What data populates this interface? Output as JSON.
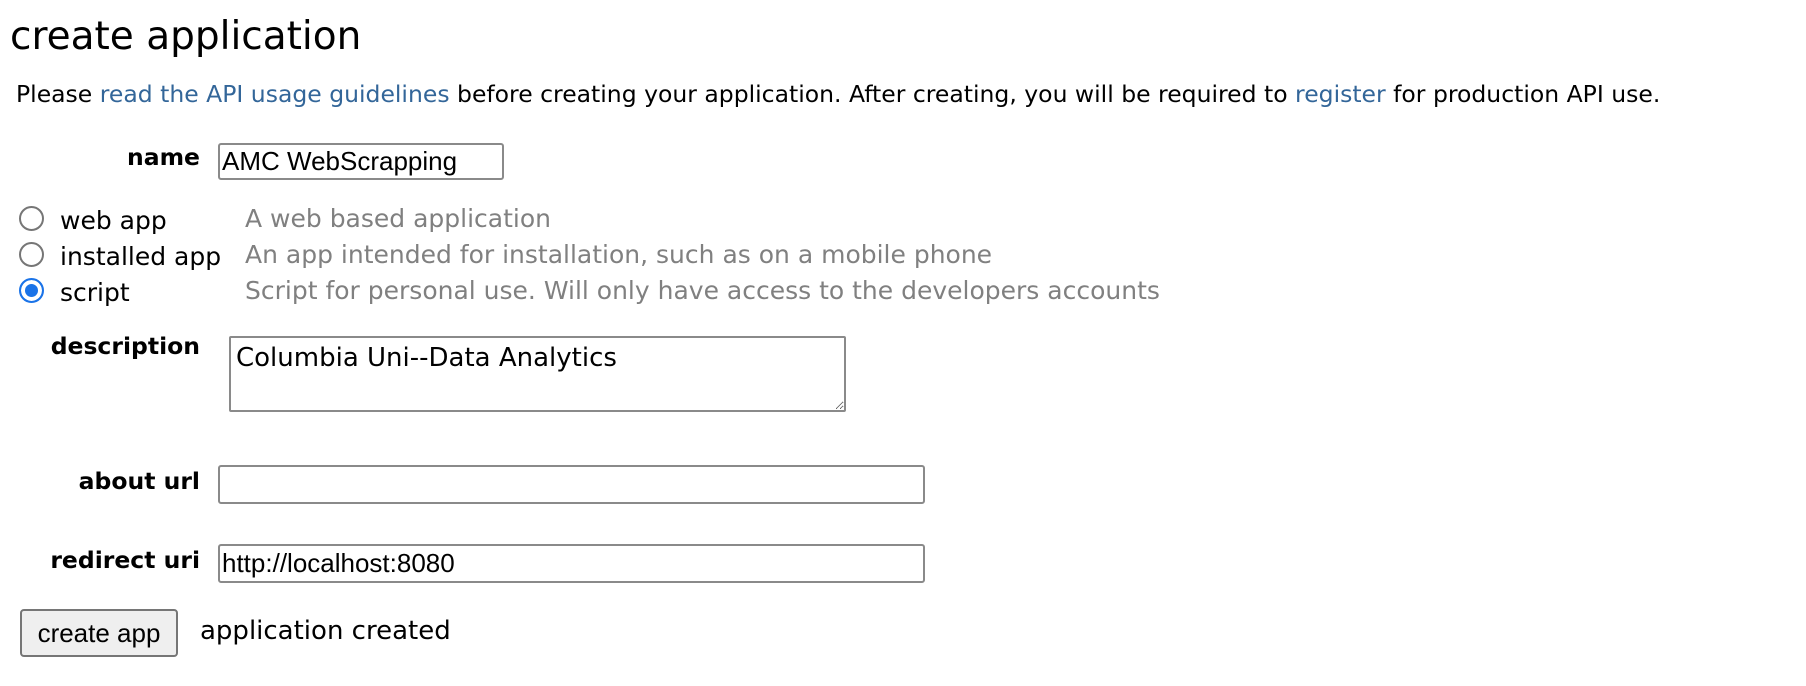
{
  "title": "create application",
  "intro": {
    "text_before_link1": "Please ",
    "link1": "read the API usage guidelines",
    "text_between": " before creating your application. After creating, you will be required to ",
    "link2": "register",
    "text_after": " for production API use."
  },
  "fields": {
    "name": {
      "label": "name",
      "value": "AMC WebScrapping"
    },
    "description": {
      "label": "description",
      "value": "Columbia Uni--Data Analytics"
    },
    "about_url": {
      "label": "about url",
      "value": ""
    },
    "redirect_uri": {
      "label": "redirect uri",
      "value": "http://localhost:8080"
    }
  },
  "app_types": [
    {
      "label": "web app",
      "hint": "A web based application",
      "selected": false
    },
    {
      "label": "installed app",
      "hint": "An app intended for installation, such as on a mobile phone",
      "selected": false
    },
    {
      "label": "script",
      "hint": "Script for personal use. Will only have access to the developers accounts",
      "selected": true
    }
  ],
  "submit": {
    "label": "create app"
  },
  "status": "application created"
}
